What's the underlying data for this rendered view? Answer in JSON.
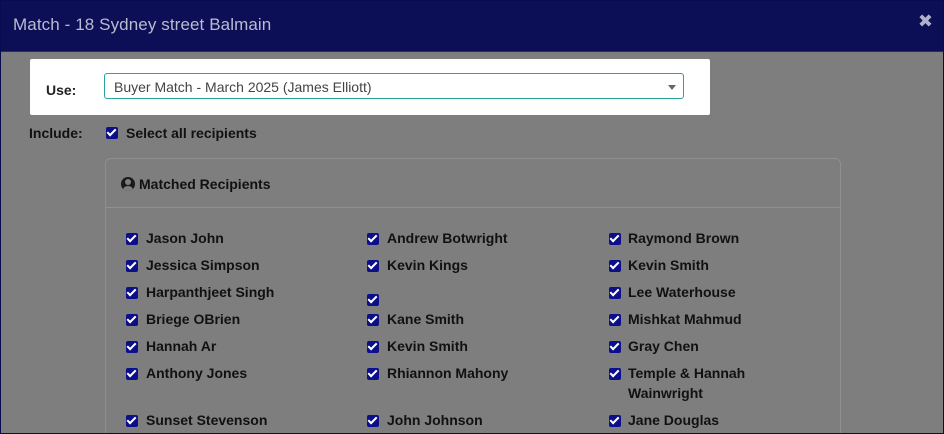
{
  "modal": {
    "title": "Match - 18 Sydney street Balmain",
    "close_glyph": "✖"
  },
  "use": {
    "label": "Use:",
    "selected": "Buyer Match - March 2025 (James Elliott)"
  },
  "include": {
    "label": "Include:",
    "select_all_label": "Select all recipients",
    "select_all_checked": true
  },
  "panel": {
    "title": "Matched Recipients",
    "icon": "user-circle-icon"
  },
  "recipients": {
    "col1": [
      "Jason John",
      "Jessica Simpson",
      "Harpanthjeet Singh",
      "Briege OBrien",
      "Hannah Ar",
      "Anthony Jones",
      "Sunset Stevenson"
    ],
    "col2": [
      "Andrew Botwright",
      "Kevin Kings",
      "",
      "Kane Smith",
      "Kevin Smith",
      "Rhiannon Mahony",
      "John Johnson"
    ],
    "col3": [
      "Raymond Brown",
      "Kevin Smith",
      "Lee Waterhouse",
      "Mishkat Mahmud",
      "Gray Chen",
      "Temple & Hannah Wainwright",
      "Jane Douglas"
    ]
  },
  "colors": {
    "header_bg": "#0c0e56",
    "checkbox": "#0c0e8a",
    "select_border": "#2aa39a",
    "overlay": "#7e7e7e"
  }
}
